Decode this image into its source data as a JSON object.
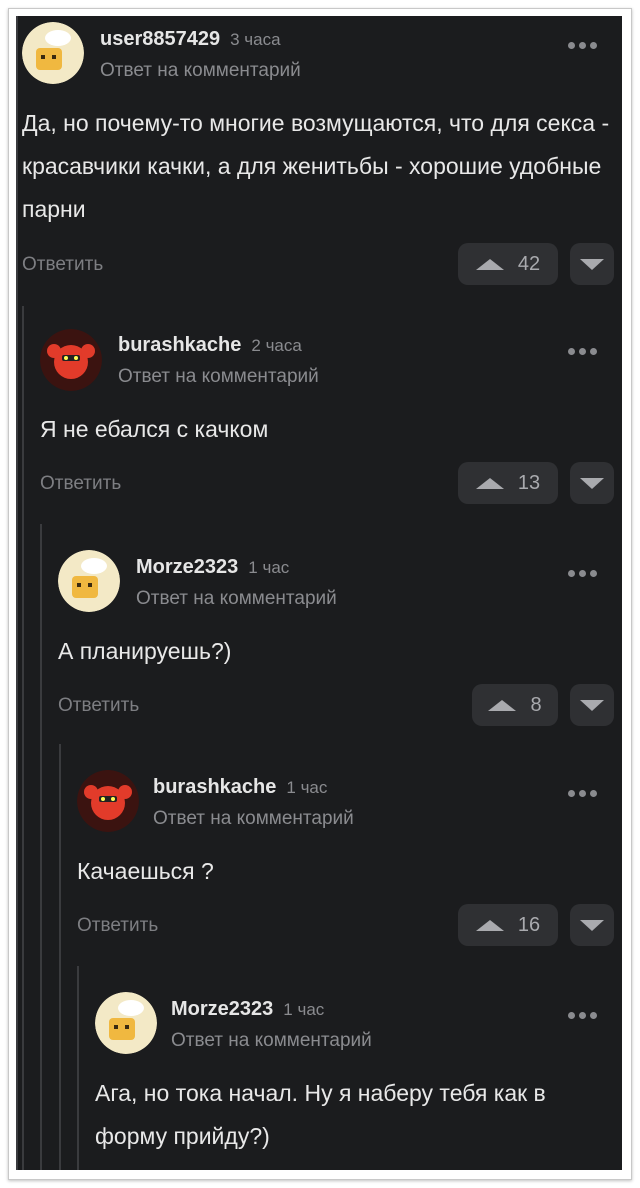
{
  "comments": [
    {
      "user": "user8857429",
      "time": "3 часа",
      "reply_to": "Ответ на комментарий",
      "text": "Да, но почему-то многие возмущаются, что для секса - красавчики качки, а для женитьбы - хорошие удобные парни",
      "reply": "Ответить",
      "votes": "42",
      "avatar": "chef-avatar"
    },
    {
      "user": "burashkache",
      "time": "2 часа",
      "reply_to": "Ответ на комментарий",
      "text": "Я не ебался с качком",
      "reply": "Ответить",
      "votes": "13",
      "avatar": "lobster-avatar"
    },
    {
      "user": "Morze2323",
      "time": "1 час",
      "reply_to": "Ответ на комментарий",
      "text": "А планируешь?)",
      "reply": "Ответить",
      "votes": "8",
      "avatar": "chef-avatar"
    },
    {
      "user": "burashkache",
      "time": "1 час",
      "reply_to": "Ответ на комментарий",
      "text": "Качаешься ?",
      "reply": "Ответить",
      "votes": "16",
      "avatar": "lobster-avatar"
    },
    {
      "user": "Morze2323",
      "time": "1 час",
      "reply_to": "Ответ на комментарий",
      "text": "Ага, но тока начал. Ну я наберу тебя как в форму прийду?)",
      "avatar": "chef-avatar"
    }
  ]
}
